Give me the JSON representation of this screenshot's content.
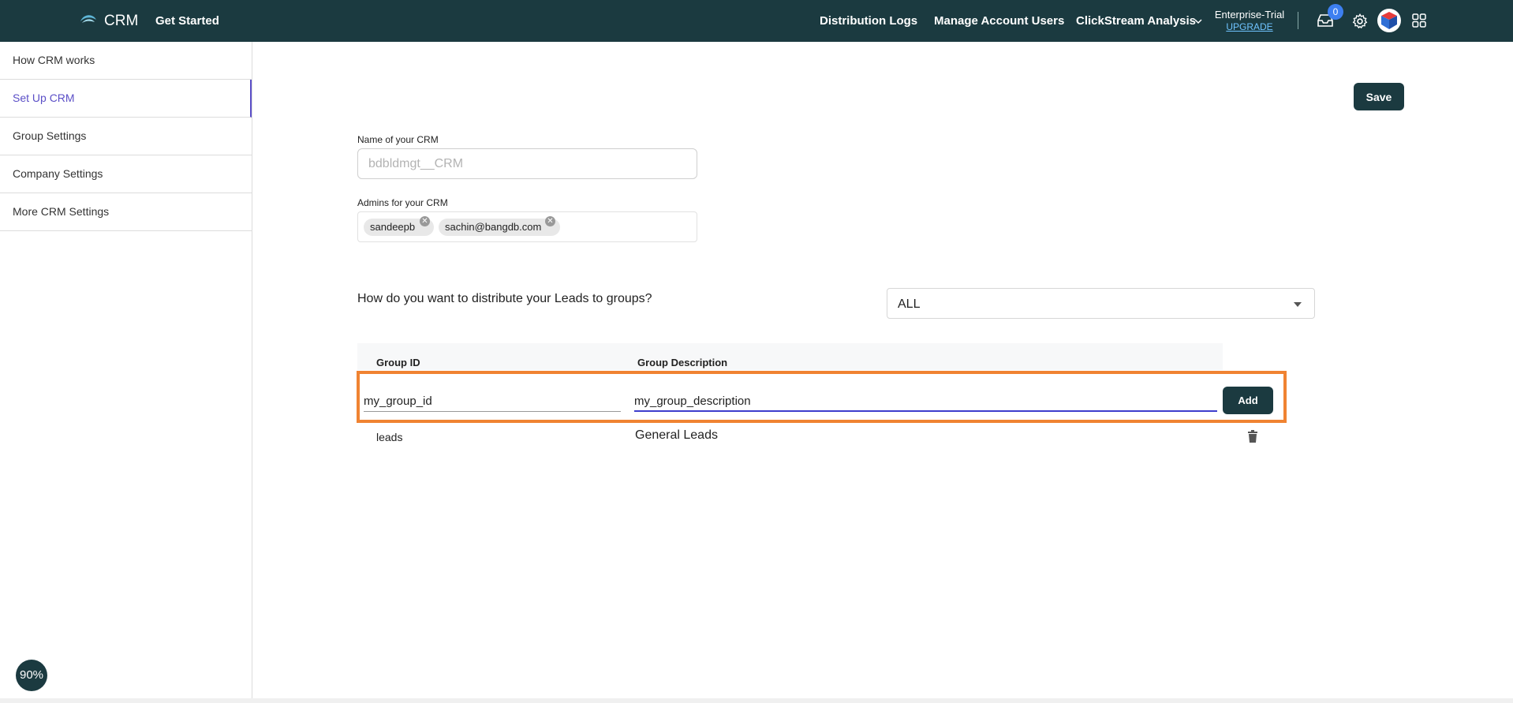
{
  "header": {
    "brand": "CRM",
    "get_started": "Get Started",
    "nav": [
      "Distribution Logs",
      "Manage Account Users",
      "ClickStream Analysis"
    ],
    "plan": "Enterprise-Trial",
    "upgrade": "UPGRADE",
    "notifications_count": "0"
  },
  "sidebar": {
    "items": [
      {
        "label": "How CRM works"
      },
      {
        "label": "Set Up CRM",
        "active": true
      },
      {
        "label": "Group Settings"
      },
      {
        "label": "Company Settings"
      },
      {
        "label": "More CRM Settings"
      }
    ]
  },
  "main": {
    "save_label": "Save",
    "crm_name_label": "Name of your CRM",
    "crm_name_placeholder": "bdbldmgt__CRM",
    "admins_label": "Admins for your CRM",
    "admins": [
      "sandeepb",
      "sachin@bangdb.com"
    ],
    "distribution_question": "How do you want to distribute your Leads to groups?",
    "distribution_value": "ALL",
    "table": {
      "columns": [
        "Group ID",
        "Group Description"
      ],
      "new_row": {
        "group_id": "my_group_id",
        "group_description": "my_group_description"
      },
      "add_label": "Add",
      "rows": [
        {
          "group_id": "leads",
          "group_description": "General Leads"
        }
      ]
    }
  },
  "zoom": "90%",
  "colors": {
    "header_bg": "#1b3a40",
    "accent": "#5b4fc7",
    "highlight": "#f08332"
  }
}
